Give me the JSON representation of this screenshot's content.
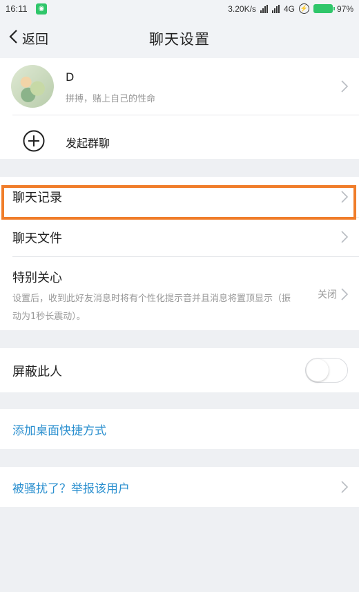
{
  "statusbar": {
    "time": "16:11",
    "network_speed": "3.20K/s",
    "network_type": "4G",
    "battery": "97%"
  },
  "titlebar": {
    "back_label": "返回",
    "title": "聊天设置"
  },
  "profile": {
    "name": "D",
    "signature": "拼搏，赌上自己的性命"
  },
  "group_chat": {
    "label": "发起群聊"
  },
  "chat_records": {
    "label": "聊天记录"
  },
  "chat_files": {
    "label": "聊天文件"
  },
  "special_care": {
    "label": "特别关心",
    "description": "设置后，收到此好友消息时将有个性化提示音并且消息将置顶显示（振动为1秒长震动）。",
    "status": "关闭"
  },
  "block_user": {
    "label": "屏蔽此人",
    "enabled": false
  },
  "shortcut": {
    "label": "添加桌面快捷方式"
  },
  "report": {
    "label": "被骚扰了？举报该用户"
  },
  "colors": {
    "accent_link": "#2a8fcf",
    "highlight": "#f07d2a",
    "background": "#eef0f3"
  }
}
